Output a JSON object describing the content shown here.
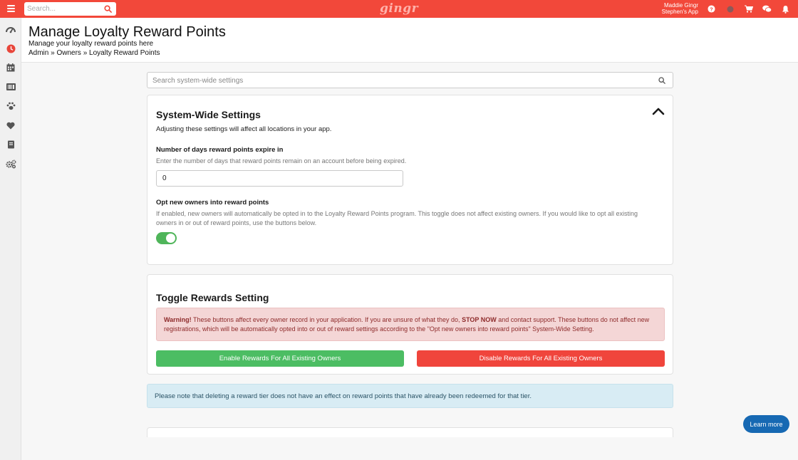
{
  "topbar": {
    "search_placeholder": "Search...",
    "logo": "gingr",
    "user_name": "Maddie Gingr",
    "app_name": "Stephen's App",
    "icons": [
      "help-icon",
      "status-dot-icon",
      "cart-icon",
      "chat-icon",
      "bell-icon"
    ],
    "accent_color": "#f2483a"
  },
  "sidebar": {
    "items": [
      "dashboard-icon",
      "clock-icon",
      "calendar-icon",
      "barcode-icon",
      "paw-icon",
      "heart-icon",
      "book-icon",
      "settings-gears-icon"
    ]
  },
  "header": {
    "title": "Manage Loyalty Reward Points",
    "subtitle": "Manage your loyalty reward points here",
    "breadcrumb": "Admin » Owners » Loyalty Reward Points"
  },
  "settings_search": {
    "placeholder": "Search system-wide settings"
  },
  "system_settings": {
    "title": "System-Wide Settings",
    "description": "Adjusting these settings will affect all locations in your app.",
    "expire_label": "Number of days reward points expire in",
    "expire_help": "Enter the number of days that reward points remain on an account before being expired.",
    "expire_value": "0",
    "opt_label": "Opt new owners into reward points",
    "opt_help": "If enabled, new owners will automatically be opted in to the Loyalty Reward Points program. This toggle does not affect existing owners. If you would like to opt all existing owners in or out of reward points, use the buttons below.",
    "opt_enabled": true
  },
  "toggle_rewards": {
    "title": "Toggle Rewards Setting",
    "warning_prefix": "Warning!",
    "warning_text_1": "These buttons affect every owner record in your application. If you are unsure of what they do,",
    "warning_stop": "STOP NOW",
    "warning_text_2": "and contact support. These buttons do not affect new registrations, which will be automatically opted into or out of reward settings according to the \"Opt new owners into reward points\" System-Wide Setting.",
    "enable_label": "Enable Rewards For All Existing Owners",
    "disable_label": "Disable Rewards For All Existing Owners"
  },
  "info_note": "Please note that deleting a reward tier does not have an effect on reward points that have already been redeemed for that tier.",
  "learn_more": "Learn more"
}
